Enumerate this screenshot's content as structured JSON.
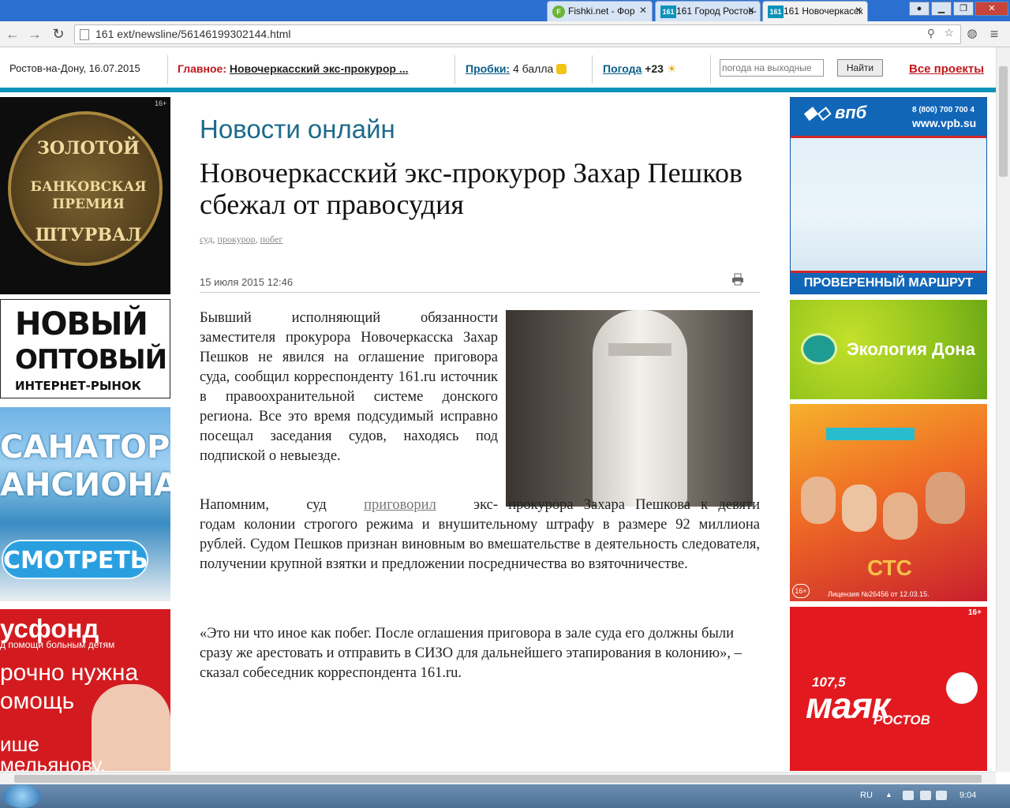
{
  "browser": {
    "tabs": [
      {
        "label": "Fishki.net - Фор",
        "favicon": "F"
      },
      {
        "label": "161 Город Ростов-",
        "favicon": "161"
      },
      {
        "label": "161 Новочеркасск",
        "favicon": "161"
      }
    ],
    "url": "161        ext/newsline/56146199302144.html"
  },
  "header": {
    "city_date": "Ростов-на-Дону, 16.07.2015",
    "main_label": "Главное:",
    "main_link": "Новочеркасский экс-прокурор ...",
    "traffic_label": "Пробки:",
    "traffic_value": "4 балла",
    "weather_label": "Погода",
    "weather_value": "+23",
    "search_placeholder": "погода на выходные",
    "find_label": "Найти",
    "all_projects": "Все проекты"
  },
  "article": {
    "section_title": "Новости онлайн",
    "title": "Новочеркасский экс-прокурор Захар Пешков сбежал от правосудия",
    "tags": [
      "суд",
      "прокурор",
      "побег"
    ],
    "date": "15 июля 2015 12:46",
    "p1": "Бывший исполняющий обязанности заместителя прокурора Новочеркасска Захар Пешков не явился на оглашение приговора суда, сообщил корреспонденту 161.ru источник в правоохранительной системе донского региона. Все это время подсудимый исправно посещал заседания судов, находясь под подпиской о невыезде.",
    "p2_before": "Напомним, суд",
    "p2_link": "приговорил",
    "p2_after": "экс-прокурора Захара Пешкова к девяти годам колонии строгого режима и внушительному штрафу в размере 92 миллиона рублей. Судом Пешков признан виновным во вмешательстве в деятельность следователя, получении крупной взятки и предложении посредничества во взяточничестве.",
    "p3": "«Это ни что иное как побег. После оглашения приговора в зале суда его должны были сразу же арестовать и отправить в СИЗО для дальнейшего этапирования в колонию», – сказал собеседник корреспондента 161.ru."
  },
  "ads_left": {
    "gold": {
      "line1": "ЗОЛОТОЙ",
      "line2": "БАНКОВСКАЯ",
      "line3": "ПРЕМИЯ",
      "line4": "ШТУРВАЛ",
      "age": "16+"
    },
    "market": {
      "line1": "НОВЫЙ",
      "line2": "ОПТОВЫЙ",
      "line3": "ИНТЕРНЕТ-РЫНОК"
    },
    "sanatorium": {
      "line1": "САНАТОРИИ",
      "line2": "АНСИОНАТЫ",
      "button": "СМОТРЕТЬ"
    },
    "rusfond": {
      "line1": "усфонд",
      "line2": "д помощи больным детям",
      "line3": "рочно нужна",
      "line4": "омощь",
      "line5": "ише",
      "line6": "мельянову,"
    }
  },
  "ads_right": {
    "vpb": {
      "brand": "впб",
      "phone": "8 (800) 700 700 4",
      "site": "www.vpb.su",
      "slogan": "ПРОВЕРЕННЫЙ МАРШРУТ"
    },
    "eco": {
      "title": "Экология Дона"
    },
    "ctc": {
      "logo": "СТС",
      "age": "16+",
      "license": "Лицензия №26456 от 12.03.15."
    },
    "mayak": {
      "freq": "107,5",
      "name": "маяк",
      "city": "РОСТОВ",
      "age": "16+"
    }
  },
  "taskbar": {
    "lang": "RU",
    "time": "9:04"
  },
  "colors": {
    "accent": "#0d92b8",
    "red": "#c0171c",
    "link": "#0b5f8a"
  }
}
